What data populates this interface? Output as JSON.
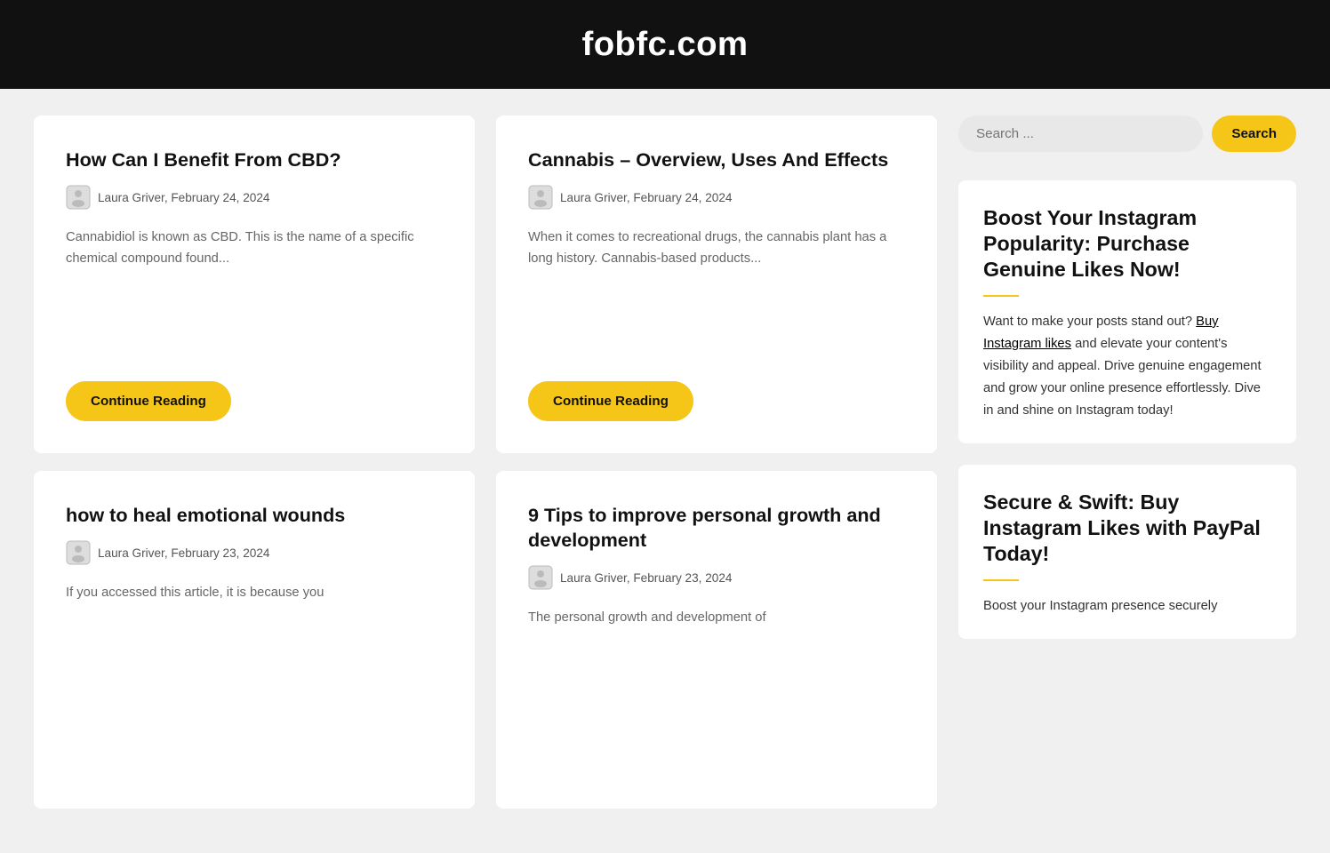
{
  "header": {
    "site_title": "fobfc.com"
  },
  "search": {
    "placeholder": "Search ...",
    "button_label": "Search"
  },
  "articles": [
    {
      "id": "cbd",
      "title": "How Can I Benefit From CBD?",
      "author": "Laura Griver",
      "date": "February 24, 2024",
      "excerpt": "Cannabidiol is known as CBD. This is the name of a specific chemical compound found...",
      "button_label": "Continue Reading"
    },
    {
      "id": "cannabis",
      "title": "Cannabis – Overview, Uses And Effects",
      "author": "Laura Griver",
      "date": "February 24, 2024",
      "excerpt": "When it comes to recreational drugs, the cannabis plant has a long history. Cannabis-based products...",
      "button_label": "Continue Reading"
    },
    {
      "id": "emotional",
      "title": "how to heal emotional wounds",
      "author": "Laura Griver",
      "date": "February 23, 2024",
      "excerpt": "If you accessed this article, it is because you",
      "button_label": null
    },
    {
      "id": "personal-growth",
      "title": "9 Tips to improve personal growth and development",
      "author": "Laura Griver",
      "date": "February 23, 2024",
      "excerpt": "The personal growth and development of",
      "button_label": null
    }
  ],
  "sidebar": {
    "section1": {
      "title": "Boost Your Instagram Popularity: Purchase Genuine Likes Now!",
      "link_text": "Buy Instagram likes",
      "text_before_link": "Want to make your posts stand out? ",
      "text_after_link": " and elevate your content's visibility and appeal. Drive genuine engagement and grow your online presence effortlessly. Dive in and shine on Instagram today!"
    },
    "section2": {
      "title": "Secure & Swift: Buy Instagram Likes with PayPal Today!",
      "text": "Boost your Instagram presence securely"
    }
  }
}
